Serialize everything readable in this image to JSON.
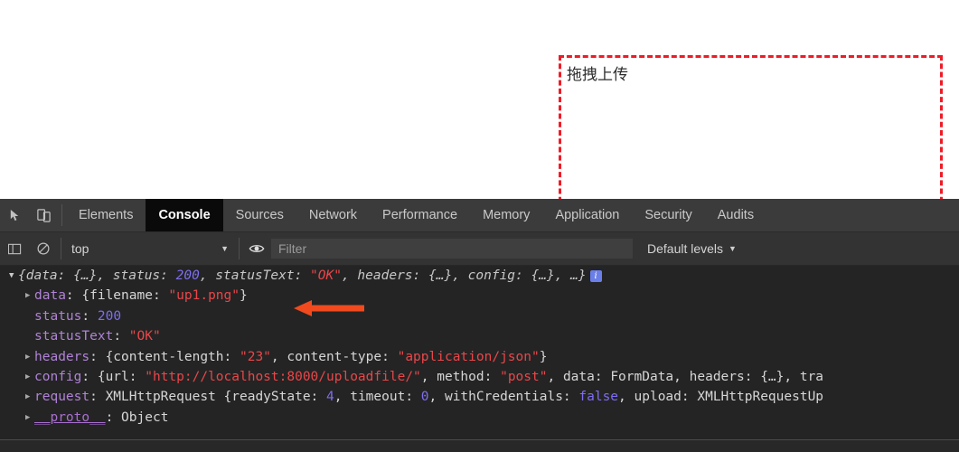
{
  "page": {
    "dropzone": {
      "label": "拖拽上传",
      "border_color": "#ef1b26"
    }
  },
  "devtools": {
    "tabbar": {
      "icons": [
        {
          "name": "inspect-element-icon",
          "glyph": "inspect"
        },
        {
          "name": "device-toolbar-icon",
          "glyph": "device"
        }
      ],
      "tabs": [
        {
          "label": "Elements",
          "active": false
        },
        {
          "label": "Console",
          "active": true
        },
        {
          "label": "Sources",
          "active": false
        },
        {
          "label": "Network",
          "active": false
        },
        {
          "label": "Performance",
          "active": false
        },
        {
          "label": "Memory",
          "active": false
        },
        {
          "label": "Application",
          "active": false
        },
        {
          "label": "Security",
          "active": false
        },
        {
          "label": "Audits",
          "active": false
        }
      ]
    },
    "filterbar": {
      "clear_console_icon": "clear-console-icon",
      "sidebar_icon": "console-sidebar-icon",
      "context_selector": "top",
      "context_caret": "▼",
      "eye_icon": "live-expression-eye-icon",
      "filter_value": "",
      "filter_placeholder": "Filter",
      "levels_label": "Default levels",
      "levels_caret": "▼"
    },
    "console": {
      "lines": [
        {
          "id": "root",
          "indent": "head",
          "triangle": "▼",
          "triangle_open": true,
          "info_badge": "i",
          "tokens": [
            {
              "t": "{data: ",
              "c": "ital"
            },
            {
              "t": "{…}",
              "c": "ital"
            },
            {
              "t": ", status: ",
              "c": "ital"
            },
            {
              "t": "200",
              "c": "num-ital"
            },
            {
              "t": ", statusText: ",
              "c": "ital"
            },
            {
              "t": "\"OK\"",
              "c": "str-ital"
            },
            {
              "t": ", headers: ",
              "c": "ital"
            },
            {
              "t": "{…}",
              "c": "ital"
            },
            {
              "t": ", config: ",
              "c": "ital"
            },
            {
              "t": "{…}",
              "c": "ital"
            },
            {
              "t": ", …}",
              "c": "ital"
            }
          ]
        },
        {
          "id": "data",
          "indent": "child",
          "triangle": "▶",
          "triangle_open": false,
          "tokens": [
            {
              "t": "data",
              "c": "prop"
            },
            {
              "t": ": {filename: ",
              "c": "plain"
            },
            {
              "t": "\"up1.png\"",
              "c": "str"
            },
            {
              "t": "}",
              "c": "plain"
            }
          ]
        },
        {
          "id": "status",
          "indent": "child",
          "triangle": "",
          "tokens": [
            {
              "t": "status",
              "c": "prop"
            },
            {
              "t": ": ",
              "c": "plain"
            },
            {
              "t": "200",
              "c": "num"
            }
          ]
        },
        {
          "id": "statusText",
          "indent": "child",
          "triangle": "",
          "tokens": [
            {
              "t": "statusText",
              "c": "prop"
            },
            {
              "t": ": ",
              "c": "plain"
            },
            {
              "t": "\"OK\"",
              "c": "str"
            }
          ]
        },
        {
          "id": "headers",
          "indent": "child",
          "triangle": "▶",
          "triangle_open": false,
          "tokens": [
            {
              "t": "headers",
              "c": "prop"
            },
            {
              "t": ": {content-length: ",
              "c": "plain"
            },
            {
              "t": "\"23\"",
              "c": "str"
            },
            {
              "t": ", content-type: ",
              "c": "plain"
            },
            {
              "t": "\"application/json\"",
              "c": "str"
            },
            {
              "t": "}",
              "c": "plain"
            }
          ]
        },
        {
          "id": "config",
          "indent": "child",
          "triangle": "▶",
          "triangle_open": false,
          "tokens": [
            {
              "t": "config",
              "c": "prop"
            },
            {
              "t": ": {url: ",
              "c": "plain"
            },
            {
              "t": "\"http://localhost:8000/uploadfile/\"",
              "c": "str"
            },
            {
              "t": ", method: ",
              "c": "plain"
            },
            {
              "t": "\"post\"",
              "c": "str"
            },
            {
              "t": ", data: ",
              "c": "plain"
            },
            {
              "t": "FormData",
              "c": "objname"
            },
            {
              "t": ", headers: {…}, tra",
              "c": "plain"
            }
          ]
        },
        {
          "id": "request",
          "indent": "child",
          "triangle": "▶",
          "triangle_open": false,
          "tokens": [
            {
              "t": "request",
              "c": "prop"
            },
            {
              "t": ": ",
              "c": "plain"
            },
            {
              "t": "XMLHttpRequest",
              "c": "objname-dim"
            },
            {
              "t": " {readyState: ",
              "c": "plain"
            },
            {
              "t": "4",
              "c": "num"
            },
            {
              "t": ", timeout: ",
              "c": "plain"
            },
            {
              "t": "0",
              "c": "num"
            },
            {
              "t": ", withCredentials: ",
              "c": "plain"
            },
            {
              "t": "false",
              "c": "num"
            },
            {
              "t": ", upload: ",
              "c": "plain"
            },
            {
              "t": "XMLHttpRequestUp",
              "c": "objname"
            }
          ]
        },
        {
          "id": "proto",
          "indent": "child",
          "triangle": "▶",
          "triangle_open": false,
          "tokens": [
            {
              "t": "__proto__",
              "c": "link"
            },
            {
              "t": ": ",
              "c": "plain"
            },
            {
              "t": "Object",
              "c": "objname"
            }
          ]
        }
      ]
    }
  },
  "annotation": {
    "arrow": {
      "name": "red-arrow-pointing-to-filename",
      "color": "#f04a1e",
      "direction": "left"
    }
  }
}
